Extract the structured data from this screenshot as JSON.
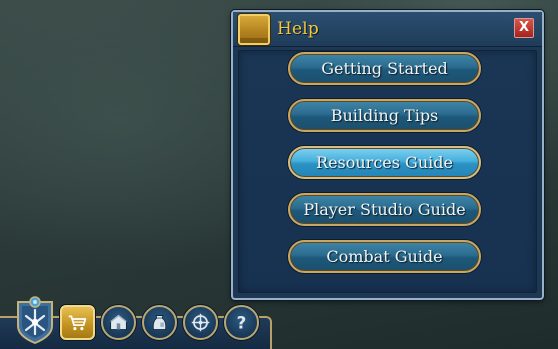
{
  "help_window": {
    "title": "Help",
    "close_label": "X",
    "buttons": [
      {
        "label": "Getting Started",
        "active": false
      },
      {
        "label": "Building Tips",
        "active": false
      },
      {
        "label": "Resources Guide",
        "active": true
      },
      {
        "label": "Player Studio Guide",
        "active": false
      },
      {
        "label": "Combat Guide",
        "active": false
      }
    ]
  },
  "toolbar": {
    "emblem_icon": "citizen-emblem-icon",
    "buttons": [
      {
        "icon": "shopping-cart-icon"
      },
      {
        "icon": "house-icon"
      },
      {
        "icon": "inventory-pouch-icon"
      },
      {
        "icon": "map-compass-icon"
      },
      {
        "icon": "question-mark-icon",
        "label": "?"
      }
    ]
  },
  "colors": {
    "panel_bg": "#1d3854",
    "title_gold": "#f3c53e",
    "button_gold_border": "#c9a664",
    "button_active": "#46afdc",
    "close_red": "#c0392b"
  }
}
